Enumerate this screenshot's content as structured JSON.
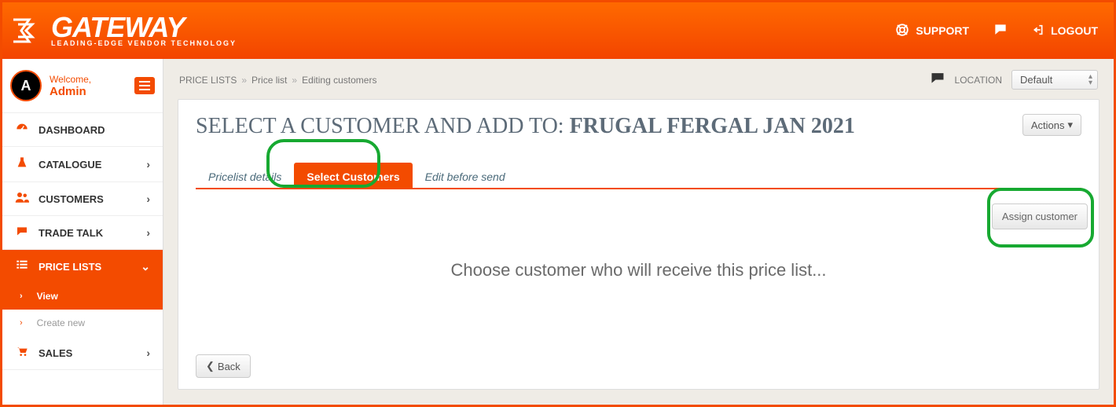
{
  "brand": {
    "name": "GATEWAY",
    "tagline": "LEADING-EDGE VENDOR TECHNOLOGY"
  },
  "topnav": {
    "support": "SUPPORT",
    "logout": "LOGOUT"
  },
  "user": {
    "welcome": "Welcome,",
    "name": "Admin",
    "initial": "A"
  },
  "sidebar": {
    "items": [
      {
        "label": "DASHBOARD"
      },
      {
        "label": "CATALOGUE"
      },
      {
        "label": "CUSTOMERS"
      },
      {
        "label": "TRADE TALK"
      },
      {
        "label": "PRICE LISTS"
      },
      {
        "label": "SALES"
      }
    ],
    "sub": {
      "view": "View",
      "create": "Create new"
    }
  },
  "breadcrumb": {
    "a": "PRICE LISTS",
    "b": "Price list",
    "c": "Editing customers"
  },
  "location": {
    "label": "LOCATION",
    "value": "Default"
  },
  "page": {
    "title_prefix": "Select a customer and add to: ",
    "title_bold": "Frugal Fergal Jan 2021",
    "actions": "Actions"
  },
  "tabs": {
    "t1": "Pricelist details",
    "t2": "Select Customers",
    "t3": "Edit before send"
  },
  "assign_label": "Assign customer",
  "empty": "Choose customer who will receive this price list...",
  "back": "Back"
}
